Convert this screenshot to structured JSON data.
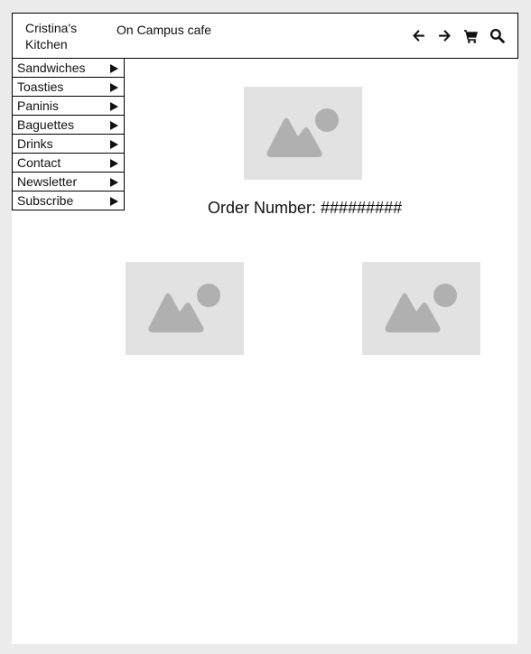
{
  "header": {
    "brand": "Cristina's Kitchen",
    "tagline": "On Campus cafe",
    "icons": [
      "back-arrow-icon",
      "forward-arrow-icon",
      "cart-icon",
      "search-icon"
    ]
  },
  "menu": {
    "items": [
      {
        "label": "Sandwiches"
      },
      {
        "label": "Toasties"
      },
      {
        "label": "Paninis"
      },
      {
        "label": "Baguettes"
      },
      {
        "label": "Drinks"
      },
      {
        "label": "Contact"
      },
      {
        "label": "Newsletter"
      },
      {
        "label": "Subscribe"
      }
    ]
  },
  "main": {
    "order_number": "Order Number: #########"
  },
  "colors": {
    "background": "#ececec",
    "page": "#ffffff",
    "placeholder": "#e2e2e2",
    "placeholder_shape": "#b0b0b0"
  }
}
